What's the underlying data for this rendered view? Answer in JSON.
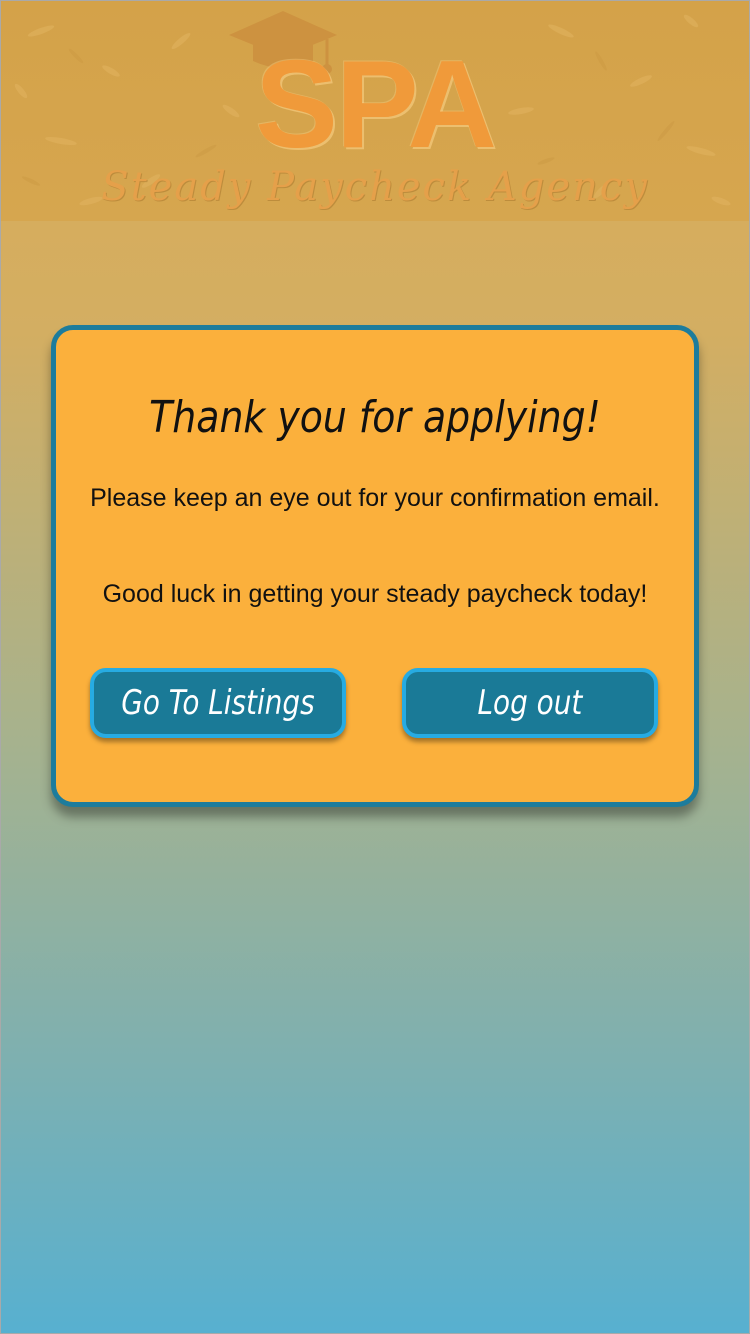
{
  "header": {
    "logo_text": "SPA",
    "tagline": "Steady Paycheck Agency",
    "logo_icon": "graduation-cap-icon"
  },
  "dialog": {
    "title": "Thank you for applying!",
    "message_1": "Please keep an eye out for your confirmation email.",
    "message_2": "Good luck in getting your steady paycheck today!",
    "listings_button_label": "Go To Listings",
    "logout_button_label": "Log out"
  },
  "colors": {
    "card_background": "#fbb03c",
    "card_border": "#1d7c9c",
    "button_background": "#1a7a97",
    "button_border": "#27abe2",
    "logo_orange": "#f09a3a"
  }
}
